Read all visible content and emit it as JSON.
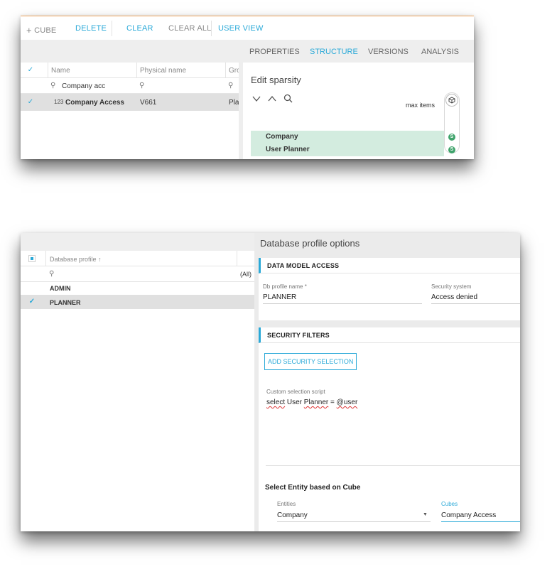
{
  "panel1": {
    "toolbar": {
      "add_cube": "CUBE",
      "delete": "DELETE",
      "clear": "CLEAR",
      "clear_all": "CLEAR ALL",
      "user_view": "USER VIEW"
    },
    "tabs": [
      "PROPERTIES",
      "STRUCTURE",
      "VERSIONS",
      "ANALYSIS"
    ],
    "active_tab": "STRUCTURE",
    "grid": {
      "headers": [
        "Name",
        "Physical name",
        "Gro"
      ],
      "filter_name": "Company acc",
      "row": {
        "icon_text": "123",
        "name": "Company Access",
        "physical": "V661",
        "group": "Pla"
      }
    },
    "sparsity": {
      "title": "Edit sparsity",
      "max_items_label": "max items",
      "rows": [
        {
          "label": "Company",
          "badge": "S"
        },
        {
          "label": "User Planner",
          "badge": "S"
        }
      ]
    }
  },
  "panel2": {
    "list": {
      "header": "Database profile",
      "sort_icon": "↑",
      "filter_all": "(All)",
      "rows": [
        {
          "label": "ADMIN",
          "selected": false
        },
        {
          "label": "PLANNER",
          "selected": true
        }
      ]
    },
    "detail": {
      "title": "Database profile options",
      "data_model_access": {
        "heading": "DATA MODEL ACCESS",
        "profile_name_label": "Db profile name *",
        "profile_name_value": "PLANNER",
        "security_system_label": "Security system",
        "security_system_value": "Access denied"
      },
      "security_filters": {
        "heading": "SECURITY FILTERS",
        "add_button": "ADD SECURITY SELECTION",
        "script_label": "Custom selection script",
        "script_parts": [
          "select",
          " User ",
          "Planner",
          " = ",
          "@user"
        ],
        "select_entity_heading": "Select Entity based on Cube",
        "entities_label": "Entities",
        "entities_value": "Company",
        "cubes_label": "Cubes",
        "cubes_value": "Company Access"
      }
    }
  },
  "colors": {
    "accent": "#2aa9d8",
    "selected_row": "#e0e0e0",
    "sparsity_row": "#d3ecdf",
    "badge": "#3fa36b"
  }
}
